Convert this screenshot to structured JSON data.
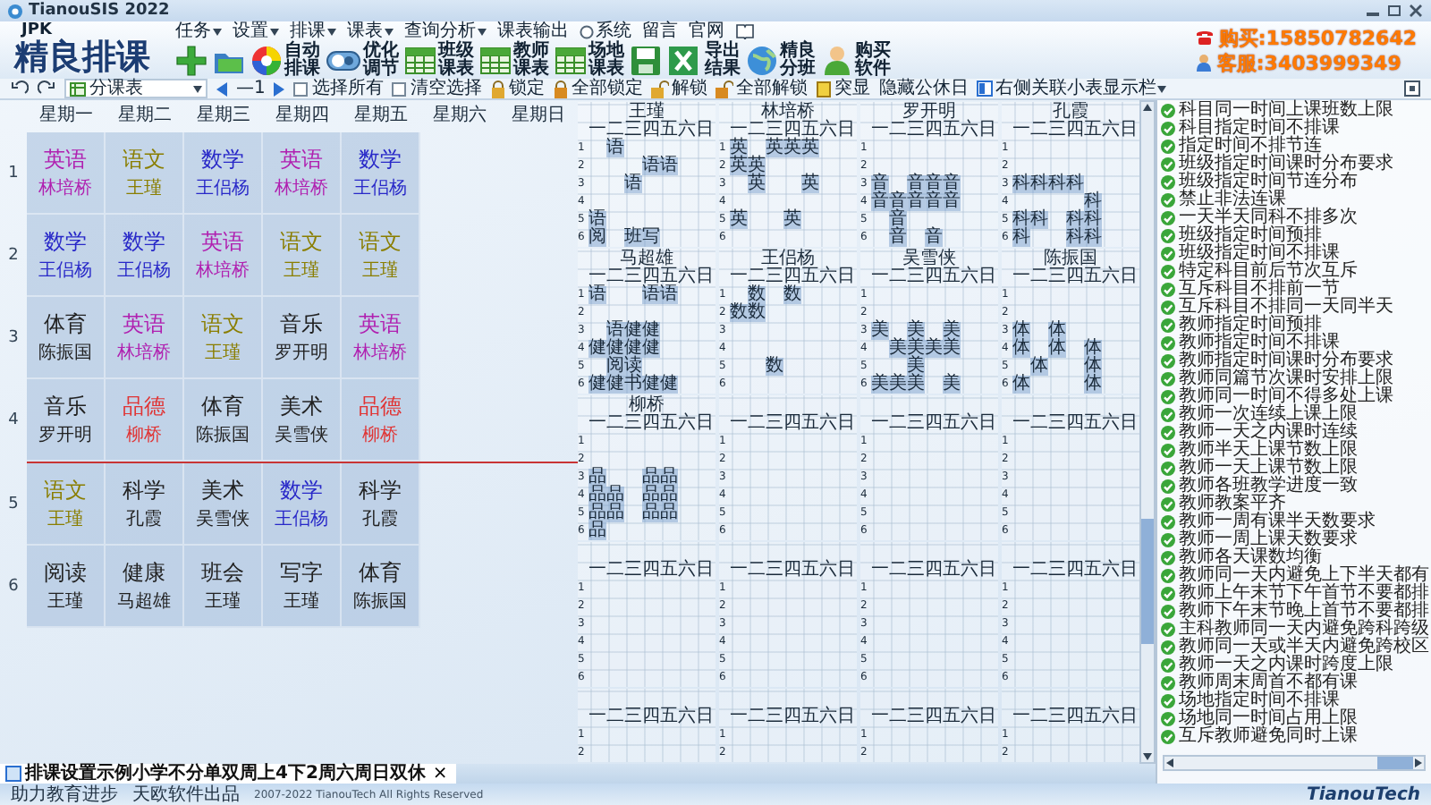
{
  "window": {
    "title": "TianouSIS 2022"
  },
  "logo": {
    "caption": "JPK",
    "title": "精良排课"
  },
  "menu": [
    {
      "label": "任务",
      "kind": "dropdown"
    },
    {
      "label": "设置",
      "kind": "dropdown"
    },
    {
      "label": "排课",
      "kind": "dropdown"
    },
    {
      "label": "课表",
      "kind": "dropdown"
    },
    {
      "label": "查询分析",
      "kind": "dropdown"
    },
    {
      "label": "课表输出",
      "kind": "plain"
    },
    {
      "label": "系统",
      "kind": "radio"
    },
    {
      "label": "留言",
      "kind": "plain"
    },
    {
      "label": "官网",
      "kind": "plain"
    }
  ],
  "tools": [
    {
      "kind": "plus"
    },
    {
      "kind": "folder"
    },
    {
      "kind": "wheel",
      "label": "自动排课"
    },
    {
      "kind": "toggle",
      "label": "优化调节"
    },
    {
      "kind": "grid",
      "label": "班级课表"
    },
    {
      "kind": "grid",
      "label": "教师课表"
    },
    {
      "kind": "grid",
      "label": "场地课表"
    },
    {
      "kind": "save"
    },
    {
      "kind": "excel"
    },
    {
      "kind": "text",
      "label": "导出结果"
    },
    {
      "kind": "globe",
      "label": "精良分班"
    },
    {
      "kind": "person",
      "label": "购买软件"
    }
  ],
  "contacts": [
    {
      "kind": "phone",
      "text": "购买:15850782642"
    },
    {
      "kind": "person",
      "text": "客服:3403999349"
    }
  ],
  "toolbar": {
    "class_select": "分课表",
    "page": "—1",
    "select_all": {
      "label": "选择所有",
      "checked": false
    },
    "clear_selection": {
      "label": "清空选择",
      "checked": false
    },
    "actions": [
      {
        "kind": "lock",
        "label": "锁定"
      },
      {
        "kind": "lock-all",
        "label": "全部锁定"
      },
      {
        "kind": "unlock",
        "label": "解锁"
      },
      {
        "kind": "unlock-all",
        "label": "全部解锁"
      },
      {
        "kind": "highlight",
        "label": "突显"
      },
      {
        "kind": "text",
        "label": "隐藏公休日"
      }
    ],
    "side_table": "右侧关联小表显示栏"
  },
  "timetable": {
    "days": [
      "星期一",
      "星期二",
      "星期三",
      "星期四",
      "星期五",
      "星期六",
      "星期日"
    ],
    "periods": [
      {
        "label": "1",
        "break_after": false,
        "lessons": [
          {
            "subject": "英语",
            "teacher": "林培桥",
            "color": "#b020b0"
          },
          {
            "subject": "语文",
            "teacher": "王瑾",
            "color": "#8a7e00"
          },
          {
            "subject": "数学",
            "teacher": "王侣杨",
            "color": "#2828c8"
          },
          {
            "subject": "英语",
            "teacher": "林培桥",
            "color": "#b020b0"
          },
          {
            "subject": "数学",
            "teacher": "王侣杨",
            "color": "#2828c8"
          }
        ]
      },
      {
        "label": "2",
        "break_after": false,
        "lessons": [
          {
            "subject": "数学",
            "teacher": "王侣杨",
            "color": "#2828c8"
          },
          {
            "subject": "数学",
            "teacher": "王侣杨",
            "color": "#2828c8"
          },
          {
            "subject": "英语",
            "teacher": "林培桥",
            "color": "#b020b0"
          },
          {
            "subject": "语文",
            "teacher": "王瑾",
            "color": "#8a7e00"
          },
          {
            "subject": "语文",
            "teacher": "王瑾",
            "color": "#8a7e00"
          }
        ]
      },
      {
        "label": "3",
        "break_after": false,
        "lessons": [
          {
            "subject": "体育",
            "teacher": "陈振国",
            "color": "#222222"
          },
          {
            "subject": "英语",
            "teacher": "林培桥",
            "color": "#b020b0"
          },
          {
            "subject": "语文",
            "teacher": "王瑾",
            "color": "#8a7e00"
          },
          {
            "subject": "音乐",
            "teacher": "罗开明",
            "color": "#222222"
          },
          {
            "subject": "英语",
            "teacher": "林培桥",
            "color": "#b020b0"
          }
        ]
      },
      {
        "label": "4",
        "break_after": true,
        "lessons": [
          {
            "subject": "音乐",
            "teacher": "罗开明",
            "color": "#222222"
          },
          {
            "subject": "品德",
            "teacher": "柳桥",
            "color": "#e03434"
          },
          {
            "subject": "体育",
            "teacher": "陈振国",
            "color": "#222222"
          },
          {
            "subject": "美术",
            "teacher": "吴雪侠",
            "color": "#222222"
          },
          {
            "subject": "品德",
            "teacher": "柳桥",
            "color": "#e03434"
          }
        ]
      },
      {
        "label": "5",
        "break_after": false,
        "lessons": [
          {
            "subject": "语文",
            "teacher": "王瑾",
            "color": "#8a7e00"
          },
          {
            "subject": "科学",
            "teacher": "孔霞",
            "color": "#222222"
          },
          {
            "subject": "美术",
            "teacher": "吴雪侠",
            "color": "#222222"
          },
          {
            "subject": "数学",
            "teacher": "王侣杨",
            "color": "#2828c8"
          },
          {
            "subject": "科学",
            "teacher": "孔霞",
            "color": "#222222"
          }
        ]
      },
      {
        "label": "6",
        "break_after": false,
        "lessons": [
          {
            "subject": "阅读",
            "teacher": "王瑾",
            "color": "#222222"
          },
          {
            "subject": "健康",
            "teacher": "马超雄",
            "color": "#222222"
          },
          {
            "subject": "班会",
            "teacher": "王瑾",
            "color": "#222222"
          },
          {
            "subject": "写字",
            "teacher": "王瑾",
            "color": "#222222"
          },
          {
            "subject": "体育",
            "teacher": "陈振国",
            "color": "#222222"
          }
        ]
      }
    ]
  },
  "mini_tables": [
    {
      "name": "王瑾",
      "header": "一二三四五六日",
      "rows": [
        {
          "n": "1",
          "c": " 语     "
        },
        {
          "n": "2",
          "c": "   语语  "
        },
        {
          "n": "3",
          "c": "  语    "
        },
        {
          "n": "4"
        },
        {
          "n": "5",
          "c": "语      "
        },
        {
          "n": "6",
          "c": "阅 班写   "
        }
      ]
    },
    {
      "name": "林培桥",
      "header": "一二三四五六日",
      "rows": [
        {
          "n": "1",
          "c": "英 英英英  "
        },
        {
          "n": "2",
          "c": "英英     "
        },
        {
          "n": "3",
          "c": " 英  英  "
        },
        {
          "n": "4"
        },
        {
          "n": "5",
          "c": "英  英   "
        },
        {
          "n": "6"
        }
      ]
    },
    {
      "name": "罗开明",
      "header": "一二三四五六日",
      "rows": [
        {
          "n": "1"
        },
        {
          "n": "2"
        },
        {
          "n": "3",
          "c": "音 音音音  "
        },
        {
          "n": "4",
          "c": "音音音音音  "
        },
        {
          "n": "5",
          "c": " 音     "
        },
        {
          "n": "6",
          "c": " 音 音   "
        }
      ]
    },
    {
      "name": "孔霞",
      "header": "一二三四五六日",
      "rows": [
        {
          "n": "1"
        },
        {
          "n": "2"
        },
        {
          "n": "3",
          "c": "科科科科   "
        },
        {
          "n": "4",
          "c": "    科  "
        },
        {
          "n": "5",
          "c": "科科 科科  "
        },
        {
          "n": "6",
          "c": "科  科科  "
        }
      ]
    },
    {
      "name": "马超雄",
      "header": "一二三四五六日",
      "rows": [
        {
          "n": "1",
          "c": "语  语语  "
        },
        {
          "n": "2"
        },
        {
          "n": "3",
          "c": " 语健健   "
        },
        {
          "n": "4",
          "c": "健健健健   "
        },
        {
          "n": "5",
          "c": " 阅读    "
        },
        {
          "n": "6",
          "c": "健健书健健  "
        }
      ]
    },
    {
      "name": "王侣杨",
      "header": "一二三四五六日",
      "rows": [
        {
          "n": "1",
          "c": " 数 数   "
        },
        {
          "n": "2",
          "c": "数数     "
        },
        {
          "n": "3"
        },
        {
          "n": "4"
        },
        {
          "n": "5",
          "c": "  数    "
        },
        {
          "n": "6"
        }
      ]
    },
    {
      "name": "吴雪侠",
      "header": "一二三四五六日",
      "rows": [
        {
          "n": "1"
        },
        {
          "n": "2"
        },
        {
          "n": "3",
          "c": "美 美 美  "
        },
        {
          "n": "4",
          "c": " 美美美美  "
        },
        {
          "n": "5",
          "c": "  美    "
        },
        {
          "n": "6",
          "c": "美美美 美  "
        }
      ]
    },
    {
      "name": "陈振国",
      "header": "一二三四五六日",
      "rows": [
        {
          "n": "1"
        },
        {
          "n": "2"
        },
        {
          "n": "3",
          "c": "体 体    "
        },
        {
          "n": "4",
          "c": "体 体 体  "
        },
        {
          "n": "5",
          "c": " 体  体  "
        },
        {
          "n": "6",
          "c": "体   体  "
        }
      ]
    },
    {
      "name": "柳桥",
      "header": "一二三四五六日",
      "rows": [
        {
          "n": "1"
        },
        {
          "n": "2"
        },
        {
          "n": "3",
          "c": "品  品品  "
        },
        {
          "n": "4",
          "c": "品品 品品  "
        },
        {
          "n": "5",
          "c": "品品 品品  "
        },
        {
          "n": "6",
          "c": "品      "
        }
      ]
    },
    {
      "header": "一二三四五六日",
      "rows": [
        {
          "n": "1"
        },
        {
          "n": "2"
        },
        {
          "n": "3"
        },
        {
          "n": "4"
        },
        {
          "n": "5"
        },
        {
          "n": "6"
        }
      ]
    },
    {
      "header": "一二三四五六日",
      "rows": [
        {
          "n": "1"
        },
        {
          "n": "2"
        },
        {
          "n": "3"
        },
        {
          "n": "4"
        },
        {
          "n": "5"
        },
        {
          "n": "6"
        }
      ]
    },
    {
      "header": "一二三四五六日",
      "rows": [
        {
          "n": "1"
        },
        {
          "n": "2"
        },
        {
          "n": "3"
        },
        {
          "n": "4"
        },
        {
          "n": "5"
        },
        {
          "n": "6"
        }
      ]
    },
    {
      "header": "一二三四五六日",
      "rows": [
        {
          "n": "1"
        },
        {
          "n": "2"
        },
        {
          "n": "3"
        },
        {
          "n": "4"
        },
        {
          "n": "5"
        },
        {
          "n": "6"
        }
      ]
    },
    {
      "header": "一二三四五六日",
      "rows": [
        {
          "n": "1"
        },
        {
          "n": "2"
        },
        {
          "n": "3"
        },
        {
          "n": "4"
        },
        {
          "n": "5"
        },
        {
          "n": "6"
        }
      ]
    },
    {
      "header": "一二三四五六日",
      "rows": [
        {
          "n": "1"
        },
        {
          "n": "2"
        },
        {
          "n": "3"
        },
        {
          "n": "4"
        },
        {
          "n": "5"
        },
        {
          "n": "6"
        }
      ]
    },
    {
      "header": "一二三四五六日",
      "rows": [
        {
          "n": "1"
        },
        {
          "n": "2"
        },
        {
          "n": "3"
        },
        {
          "n": "4"
        },
        {
          "n": "5"
        },
        {
          "n": "6"
        }
      ]
    },
    {
      "header": "一二三四五六日",
      "rows": [
        {
          "n": "1"
        },
        {
          "n": "2"
        }
      ]
    },
    {
      "header": "一二三四五六日",
      "rows": [
        {
          "n": "1"
        },
        {
          "n": "2"
        }
      ]
    },
    {
      "header": "一二三四五六日",
      "rows": [
        {
          "n": "1"
        },
        {
          "n": "2"
        }
      ]
    },
    {
      "header": "一二三四五六日",
      "rows": [
        {
          "n": "1"
        },
        {
          "n": "2"
        }
      ]
    }
  ],
  "rules": [
    "科目同一时间上课班数上限",
    "科目指定时间不排课",
    "指定时间不排节连",
    "班级指定时间课时分布要求",
    "班级指定时间节连分布",
    "禁止非法连课",
    "一天半天同科不排多次",
    "班级指定时间预排",
    "班级指定时间不排课",
    "特定科目前后节次互斥",
    "互斥科目不排前一节",
    "互斥科目不排同一天同半天",
    "教师指定时间预排",
    "教师指定时间不排课",
    "教师指定时间课时分布要求",
    "教师同篇节次课时安排上限",
    "教师同一时间不得多处上课",
    "教师一次连续上课上限",
    "教师一天之内课时连续",
    "教师半天上课节数上限",
    "教师一天上课节数上限",
    "教师各班教学进度一致",
    "教师教案平齐",
    "教师一周有课半天数要求",
    "教师一周上课天数要求",
    "教师各天课数均衡",
    "教师同一天内避免上下半天都有",
    "教师上午末节下午首节不要都排",
    "教师下午末节晚上首节不要都排",
    "主科教师同一天内避免跨科跨级",
    "教师同一天或半天内避免跨校区",
    "教师一天之内课时跨度上限",
    "教师周末周首不都有课",
    "场地指定时间不排课",
    "场地同一时间占用上限",
    "互斥教师避免同时上课"
  ],
  "document_tab": {
    "title": "排课设置示例小学不分单双周上4下2周六周日双休",
    "close": "×"
  },
  "status": {
    "slogan": [
      "助力教育进步",
      "天欧软件出品"
    ],
    "copyright": "2007-2022 TianouTech All Rights Reserved",
    "brand": "TianouTech"
  }
}
